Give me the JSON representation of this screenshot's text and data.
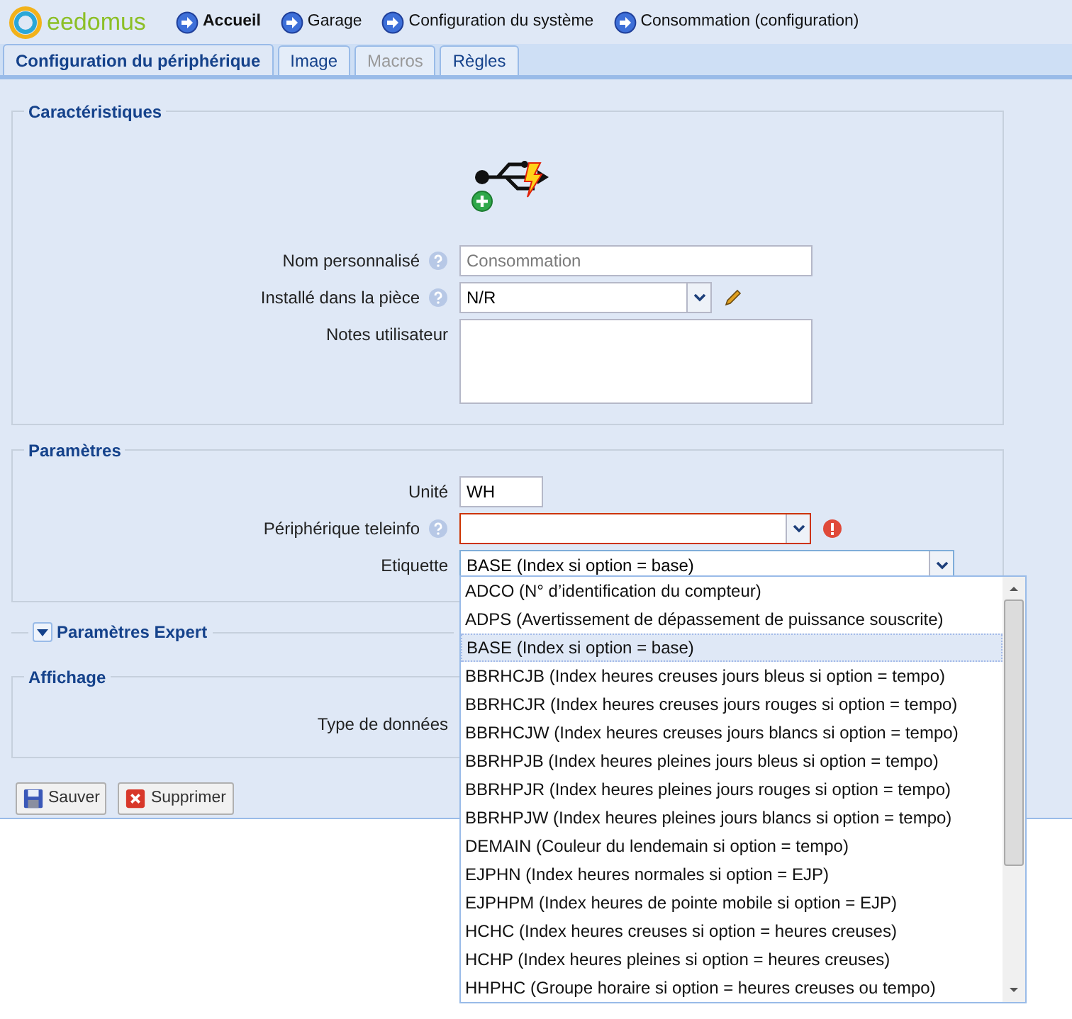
{
  "header": {
    "logo_text": "eedomus",
    "breadcrumbs": [
      {
        "label": "Accueil",
        "bold": true
      },
      {
        "label": "Garage",
        "bold": false
      },
      {
        "label": "Configuration du système",
        "bold": false
      },
      {
        "label": "Consommation (configuration)",
        "bold": false
      }
    ]
  },
  "tabs": [
    {
      "label": "Configuration du périphérique",
      "selected": true,
      "disabled": false
    },
    {
      "label": "Image",
      "selected": false,
      "disabled": false
    },
    {
      "label": "Macros",
      "selected": false,
      "disabled": true
    },
    {
      "label": "Règles",
      "selected": false,
      "disabled": false
    }
  ],
  "characteristics": {
    "title": "Caractéristiques",
    "fields": [
      {
        "kind": "text",
        "label": "Nom personnalisé",
        "help": true,
        "placeholder": "Consommation"
      },
      {
        "kind": "select",
        "label": "Installé dans la pièce",
        "help": true,
        "value": "N/R",
        "editable": true
      },
      {
        "kind": "textarea",
        "label": "Notes utilisateur",
        "help": false
      }
    ]
  },
  "parameters": {
    "title": "Paramètres",
    "fields": [
      {
        "kind": "short",
        "label": "Unité",
        "help": false,
        "value": "WH"
      },
      {
        "kind": "select",
        "label": "Périphérique teleinfo",
        "help": true,
        "error": true
      },
      {
        "kind": "dropdown",
        "label": "Etiquette",
        "help": false,
        "value": "BASE (Index si option = base)",
        "open": true,
        "options": [
          {
            "label": "ADCO (N° d’identification du compteur)",
            "selected": false
          },
          {
            "label": "ADPS (Avertissement de dépassement de puissance souscrite)",
            "selected": false
          },
          {
            "label": "BASE (Index si option = base)",
            "selected": true
          },
          {
            "label": "BBRHCJB (Index heures creuses jours bleus si option = tempo)",
            "selected": false
          },
          {
            "label": "BBRHCJR (Index heures creuses jours rouges si option = tempo)",
            "selected": false
          },
          {
            "label": "BBRHCJW (Index heures creuses jours blancs si option = tempo)",
            "selected": false
          },
          {
            "label": "BBRHPJB (Index heures pleines jours bleus si option = tempo)",
            "selected": false
          },
          {
            "label": "BBRHPJR (Index heures pleines jours rouges si option = tempo)",
            "selected": false
          },
          {
            "label": "BBRHPJW (Index heures pleines jours blancs si option = tempo)",
            "selected": false
          },
          {
            "label": "DEMAIN (Couleur du lendemain si option = tempo)",
            "selected": false
          },
          {
            "label": "EJPHN (Index heures normales si option = EJP)",
            "selected": false
          },
          {
            "label": "EJPHPM (Index heures de pointe mobile si option = EJP)",
            "selected": false
          },
          {
            "label": "HCHC (Index heures creuses si option = heures creuses)",
            "selected": false
          },
          {
            "label": "HCHP (Index heures pleines si option = heures creuses)",
            "selected": false
          },
          {
            "label": "HHPHC (Groupe horaire si option = heures creuses ou tempo)",
            "selected": false
          }
        ]
      }
    ]
  },
  "expert": {
    "title": "Paramètres Expert",
    "expanded": false
  },
  "display": {
    "title": "Affichage",
    "fields": [
      {
        "kind": "label",
        "label": "Type de données"
      }
    ]
  },
  "buttons": [
    {
      "kind": "save",
      "label": "Sauver"
    },
    {
      "kind": "delete",
      "label": "Supprimer"
    }
  ]
}
